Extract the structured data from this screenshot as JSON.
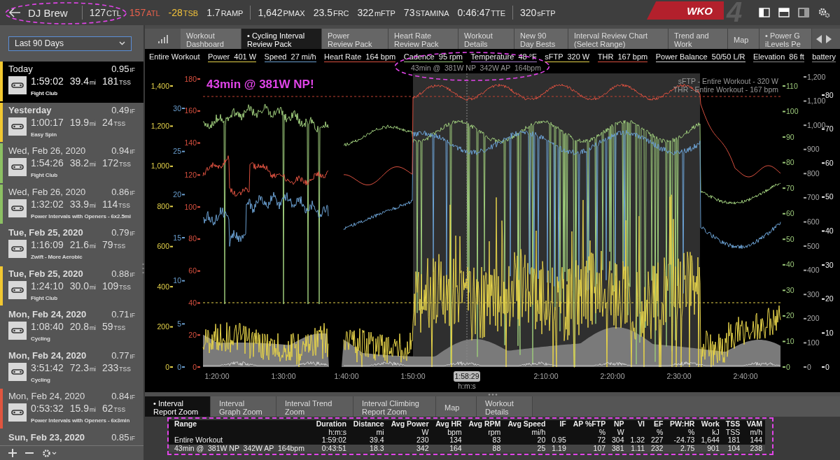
{
  "top_bar": {
    "athlete": "DJ Brew",
    "metric_groups": [
      [
        {
          "value": "127",
          "unit": "CTL",
          "color": "#e8e8e8"
        },
        {
          "value": "157",
          "unit": "ATL",
          "color": "#e8604c"
        },
        {
          "value": "-28",
          "unit": "TSB",
          "color": "#f2c23a"
        },
        {
          "value": "1.7",
          "unit": "RAMP",
          "color": "#e8e8e8"
        }
      ],
      [
        {
          "value": "1,642",
          "unit": "PMAX",
          "color": "#e8e8e8"
        },
        {
          "value": "23.5",
          "unit": "FRC",
          "color": "#e8e8e8"
        },
        {
          "value": "322",
          "unit": "mFTP",
          "color": "#e8e8e8"
        },
        {
          "value": "73",
          "unit": "STAMINA",
          "color": "#e8e8e8"
        },
        {
          "value": "0:46:47",
          "unit": "TTE",
          "color": "#e8e8e8"
        }
      ],
      [
        {
          "value": "320",
          "unit": "sFTP",
          "color": "#e8e8e8"
        }
      ]
    ],
    "logo": {
      "text": "WKO",
      "numeral": "4"
    }
  },
  "sidebar": {
    "range": "Last 90 Days",
    "workouts": [
      {
        "date": "Today",
        "bold": false,
        "selected": true,
        "color": "#f2c831",
        "intensity": "0.95",
        "intensity_unit": "IF",
        "duration": "1:59:02",
        "distance": "39.4",
        "distance_unit": "mi",
        "tss": "181",
        "tss_unit": "TSS",
        "name": "Fight Club"
      },
      {
        "date": "Yesterday",
        "bold": true,
        "selected": false,
        "color": "#f2c831",
        "intensity": "0.49",
        "intensity_unit": "IF",
        "duration": "1:00:17",
        "distance": "19.9",
        "distance_unit": "mi",
        "tss": "24",
        "tss_unit": "TSS",
        "name": "Easy Spin"
      },
      {
        "date": "Wed, Feb 26, 2020",
        "bold": false,
        "selected": false,
        "color": "#8cc063",
        "intensity": "0.94",
        "intensity_unit": "IF",
        "duration": "1:54:26",
        "distance": "38.2",
        "distance_unit": "mi",
        "tss": "172",
        "tss_unit": "TSS",
        "name": "Fight Club"
      },
      {
        "date": "Wed, Feb 26, 2020",
        "bold": false,
        "selected": false,
        "color": "#8cc063",
        "intensity": "0.86",
        "intensity_unit": "IF",
        "duration": "1:32:02",
        "distance": "33.9",
        "distance_unit": "mi",
        "tss": "114",
        "tss_unit": "TSS",
        "name": "Power Intervals with Openers - 6x2.5mi"
      },
      {
        "date": "Tue, Feb 25, 2020",
        "bold": true,
        "selected": false,
        "intensity": "0.79",
        "intensity_unit": "IF",
        "duration": "1:16:09",
        "distance": "21.6",
        "distance_unit": "mi",
        "tss": "79",
        "tss_unit": "TSS",
        "name": "Zwift - More Aerobic"
      },
      {
        "date": "Tue, Feb 25, 2020",
        "bold": true,
        "selected": false,
        "color": "#f2c831",
        "intensity": "0.88",
        "intensity_unit": "IF",
        "duration": "1:24:10",
        "distance": "30.0",
        "distance_unit": "mi",
        "tss": "109",
        "tss_unit": "TSS",
        "name": "Fight Club"
      },
      {
        "date": "Mon, Feb 24, 2020",
        "bold": true,
        "selected": false,
        "intensity": "0.71",
        "intensity_unit": "IF",
        "duration": "1:08:40",
        "distance": "20.8",
        "distance_unit": "mi",
        "tss": "59",
        "tss_unit": "TSS",
        "name": "Cycling"
      },
      {
        "date": "Mon, Feb 24, 2020",
        "bold": true,
        "selected": false,
        "intensity": "0.77",
        "intensity_unit": "IF",
        "duration": "3:51:42",
        "distance": "72.3",
        "distance_unit": "mi",
        "tss": "233",
        "tss_unit": "TSS",
        "name": "Cycling"
      },
      {
        "date": "Mon, Feb 24, 2020",
        "bold": false,
        "selected": false,
        "color": "#e0553f",
        "intensity": "0.84",
        "intensity_unit": "IF",
        "duration": "0:53:32",
        "distance": "15.9",
        "distance_unit": "mi",
        "tss": "62",
        "tss_unit": "TSS",
        "name": "Power Intervals with Openers - 6x3min"
      },
      {
        "date": "Sun, Feb 23, 2020",
        "bold": true,
        "selected": false,
        "intensity": "0.85",
        "intensity_unit": "IF"
      }
    ]
  },
  "tabs": [
    {
      "lines": [
        "Workout",
        "Dashboard"
      ],
      "selected": false
    },
    {
      "lines": [
        "• Cycling Interval",
        "Review Pack"
      ],
      "selected": true
    },
    {
      "lines": [
        "Power",
        "Review Pack"
      ],
      "selected": false
    },
    {
      "lines": [
        "Heart Rate",
        "Review Pack"
      ],
      "selected": false
    },
    {
      "lines": [
        "Workout",
        "Details"
      ],
      "selected": false
    },
    {
      "lines": [
        "New 90",
        "Day Bests"
      ],
      "selected": false
    },
    {
      "lines": [
        "Interval Review Chart",
        "(Select Range)"
      ],
      "selected": false
    },
    {
      "lines": [
        "Trend and",
        "Work"
      ],
      "selected": false
    },
    {
      "lines": [
        "Map"
      ],
      "selected": false
    },
    {
      "lines": [
        "• Power G",
        "iLevels Pe"
      ],
      "selected": false
    }
  ],
  "chart": {
    "scope": "Entire Workout",
    "legend": [
      {
        "text": "Power  401 W",
        "color": "#e6d34a"
      },
      {
        "text": "Speed  27 mi/h",
        "color": "#6a9fd0"
      },
      {
        "text": "Heart Rate  164 bpm",
        "color": "#d9503f"
      },
      {
        "text": "Cadence  95 rpm",
        "color": "#9cc97a"
      },
      {
        "text": "Temperature  48 °F",
        "color": "#a77cc9"
      },
      {
        "text": "sFTP  320 W",
        "color": "#e6d34a"
      },
      {
        "text": "THR  167 bpm",
        "color": "#d9503f"
      },
      {
        "text": "Power Balance  50/50 L/R",
        "color": "#d8d8d8"
      },
      {
        "text": "Elevation  86 ft",
        "color": "#8a8a8a"
      },
      {
        "text": "battery",
        "color": "#8a8a8a"
      }
    ],
    "interval_summary": "43min @  381W NP  342W AP  164bpm",
    "callout": "43min @ 381W NP!",
    "reference_labels": [
      "sFTP - Entire Workout - 320 W",
      "THR - Entire Workout - 167 bpm"
    ],
    "left_axes": [
      {
        "color": "#e6d34a",
        "ticks": [
          "1,400",
          "1,200",
          "1,000",
          "800",
          "600",
          "400",
          "200",
          "0"
        ]
      },
      {
        "color": "#6a9fd0",
        "ticks": [
          "30",
          "25",
          "20",
          "15",
          "10",
          "5",
          "0"
        ]
      },
      {
        "color": "#d9503f",
        "ticks": [
          "180",
          "160",
          "140",
          "120",
          "100",
          "80",
          "60",
          "40",
          "20",
          "0"
        ]
      }
    ],
    "right_axes": [
      {
        "color": "#9cc97a",
        "ticks": [
          "110",
          "100",
          "90",
          "80",
          "70",
          "60",
          "50",
          "40",
          "30",
          "20",
          "10",
          "0"
        ]
      },
      {
        "color": "#a8a8a8",
        "ticks": [
          "1,200",
          "1,100",
          "1,000",
          "900",
          "800",
          "700",
          "600",
          "500",
          "400",
          "300",
          "200",
          "100",
          "0"
        ]
      },
      {
        "color": "#f0f0f0",
        "ticks": [
          "80",
          "70",
          "60",
          "50",
          "40",
          "30",
          "20",
          "10",
          "0"
        ]
      }
    ],
    "x_ticks": [
      "1:20:00",
      "1:30:00",
      "1:40:00",
      "1:50:00",
      "2:10:00",
      "2:20:00",
      "2:30:00",
      "2:40:00"
    ],
    "cursor": "1:58:29",
    "x_title": "h:m:s"
  },
  "report": {
    "tabs": [
      {
        "lines": [
          "• Interval",
          "Report Zoom"
        ],
        "selected": true
      },
      {
        "lines": [
          "Interval",
          "Graph Zoom"
        ],
        "selected": false
      },
      {
        "lines": [
          "Interval Trend",
          "Zoom"
        ],
        "selected": false
      },
      {
        "lines": [
          "Interval Climbing",
          "Report Zoom"
        ],
        "selected": false
      },
      {
        "lines": [
          "Map"
        ],
        "selected": false
      },
      {
        "lines": [
          "Workout",
          "Details"
        ],
        "selected": false
      }
    ],
    "columns": [
      {
        "name": "Range"
      },
      {
        "name": "Duration",
        "unit": "h:m:s"
      },
      {
        "name": "Distance",
        "unit": "mi"
      },
      {
        "name": "Avg Power",
        "unit": "W"
      },
      {
        "name": "Avg HR",
        "unit": "bpm"
      },
      {
        "name": "Avg RPM",
        "unit": "rpm"
      },
      {
        "name": "Avg Speed",
        "unit": "mi/h"
      },
      {
        "name": "IF"
      },
      {
        "name": "AP %FTP",
        "unit": "%"
      },
      {
        "name": "NP",
        "unit": "W"
      },
      {
        "name": "VI"
      },
      {
        "name": "EF",
        "unit": "%"
      },
      {
        "name": "PW:HR",
        "unit": "%"
      },
      {
        "name": "Work",
        "unit": "kJ"
      },
      {
        "name": "TSS",
        "unit": "TSS"
      },
      {
        "name": "VAM",
        "unit": "m/h"
      }
    ],
    "rows": [
      {
        "selected": false,
        "cells": [
          "Entire Workout",
          "1:59:02",
          "39.4",
          "230",
          "134",
          "83",
          "20",
          "0.95",
          "72",
          "304",
          "1.32",
          "227",
          "-24.73",
          "1,644",
          "181",
          "144"
        ]
      },
      {
        "selected": true,
        "cells": [
          "43min @  381W NP  342W AP  164bpm",
          "0:43:51",
          "18.3",
          "342",
          "164",
          "88",
          "25",
          "1.19",
          "107",
          "381",
          "1.11",
          "232",
          "2.75",
          "901",
          "104",
          "238"
        ]
      }
    ]
  }
}
